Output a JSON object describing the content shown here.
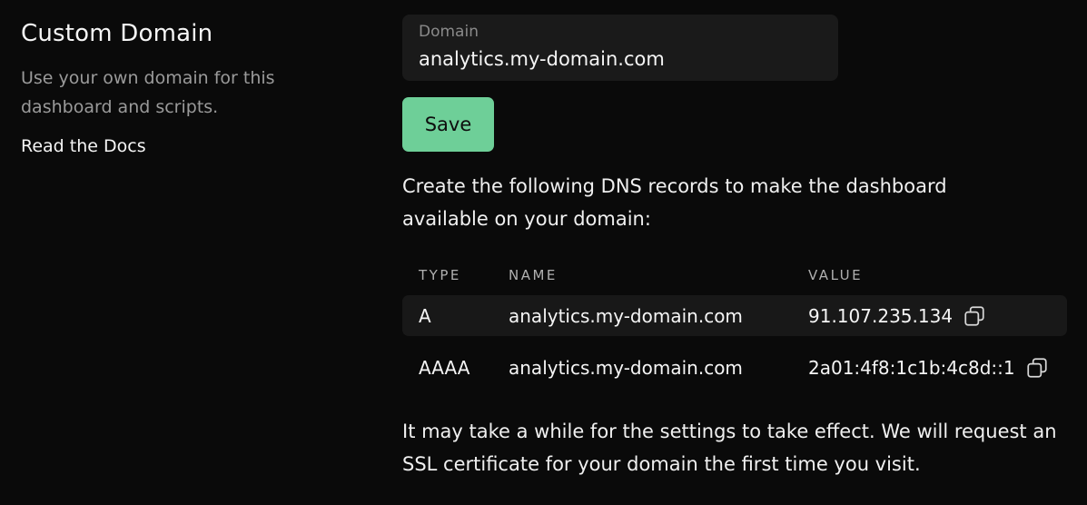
{
  "section": {
    "title": "Custom Domain",
    "description": "Use your own domain for this dashboard and scripts.",
    "docs_link": "Read the Docs"
  },
  "domain_field": {
    "label": "Domain",
    "value": "analytics.my-domain.com"
  },
  "save_label": "Save",
  "instructions": "Create the following DNS records to make the dashboard available on your domain:",
  "dns_table": {
    "headers": {
      "type": "TYPE",
      "name": "NAME",
      "value": "VALUE"
    },
    "rows": [
      {
        "type": "A",
        "name": "analytics.my-domain.com",
        "value": "91.107.235.134"
      },
      {
        "type": "AAAA",
        "name": "analytics.my-domain.com",
        "value": "2a01:4f8:1c1b:4c8d::1"
      }
    ]
  },
  "footer_note": "It may take a while for the settings to take effect. We will request an SSL certificate for your domain the first time you visit.",
  "colors": {
    "background": "#0a0a0a",
    "accent": "#6ecf98",
    "field_bg": "#1a1a1a",
    "muted_text": "#9a9a9a"
  },
  "icons": {
    "copy": "copy-icon"
  }
}
